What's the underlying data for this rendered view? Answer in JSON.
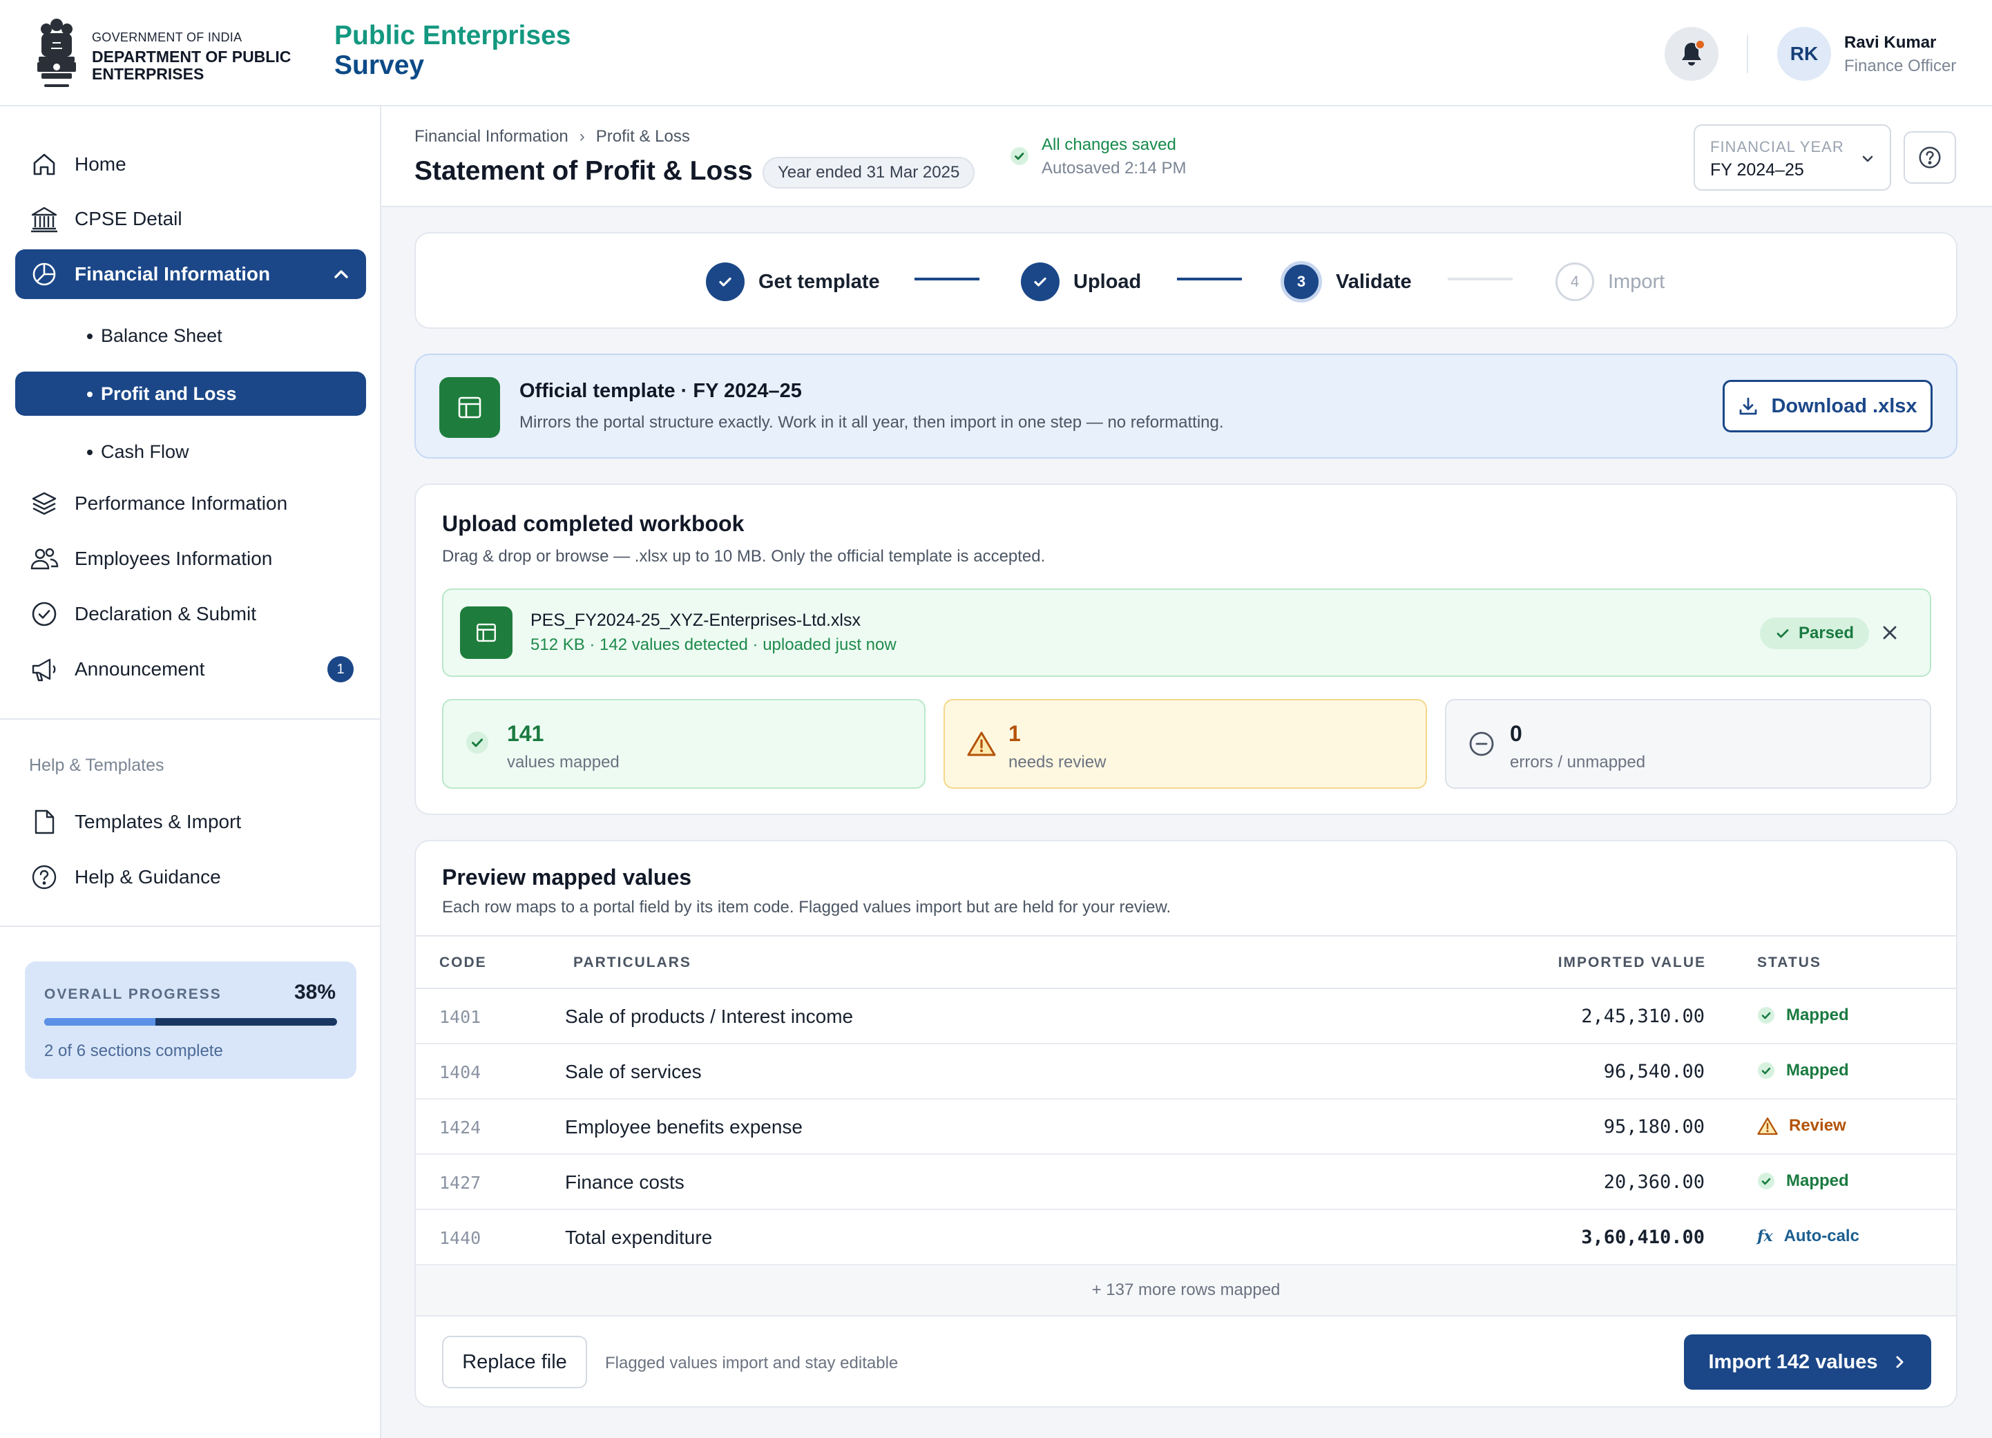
{
  "header": {
    "gov_small": "GOVERNMENT OF INDIA",
    "department": "DEPARTMENT OF PUBLIC ENTERPRISES",
    "brand_accent": "Public Enterprises",
    "brand_rest": "Survey",
    "notification_icon": "bell-icon",
    "user": {
      "initials": "RK",
      "name": "Ravi Kumar",
      "role": "Finance Officer"
    }
  },
  "sidebar": {
    "items": [
      {
        "label": "Home",
        "icon": "home-icon"
      },
      {
        "label": "CPSE Detail",
        "icon": "building-icon"
      },
      {
        "label": "Financial Information",
        "icon": "pie-chart-icon",
        "active": true,
        "expanded": true
      },
      {
        "label": "Performance Information",
        "icon": "layers-icon"
      },
      {
        "label": "Employees Information",
        "icon": "users-icon"
      },
      {
        "label": "Declaration & Submit",
        "icon": "check-circle-icon"
      },
      {
        "label": "Announcement",
        "icon": "megaphone-icon",
        "badge": "1"
      }
    ],
    "subitems": [
      {
        "label": "Balance Sheet"
      },
      {
        "label": "Profit and Loss",
        "active": true
      },
      {
        "label": "Cash Flow"
      }
    ],
    "help_label": "Help & Templates",
    "help_items": [
      {
        "label": "Templates & Import",
        "icon": "file-icon"
      },
      {
        "label": "Help & Guidance",
        "icon": "help-circle-icon"
      }
    ],
    "progress": {
      "label": "OVERALL PROGRESS",
      "percent_text": "38%",
      "fraction": 0.38,
      "sub": "2 of 6 sections complete"
    }
  },
  "page": {
    "breadcrumb": [
      "Financial Information",
      "Profit & Loss"
    ],
    "breadcrumb_sep": "›",
    "title": "Statement of Profit & Loss",
    "year_chip": "Year ended 31 Mar 2025",
    "saved": "All changes saved",
    "autosaved": "Autosaved 2:14 PM",
    "fy_label": "FINANCIAL YEAR",
    "fy_value": "FY 2024–25"
  },
  "stepper": {
    "steps": [
      {
        "label": "Get template",
        "state": "done"
      },
      {
        "label": "Upload",
        "state": "done"
      },
      {
        "label": "Validate",
        "state": "current",
        "number": "3"
      },
      {
        "label": "Import",
        "state": "future",
        "number": "4"
      }
    ]
  },
  "template": {
    "title": "Official template · FY 2024–25",
    "desc": "Mirrors the portal structure exactly. Work in it all year, then import in one step — no reformatting.",
    "download_label": "Download .xlsx"
  },
  "upload": {
    "title": "Upload completed workbook",
    "desc": "Drag & drop or browse — .xlsx up to 10 MB. Only the official template is accepted.",
    "file_name": "PES_FY2024-25_XYZ-Enterprises-Ltd.xlsx",
    "file_meta": "512 KB · 142 values detected · uploaded just now",
    "parsed_label": "Parsed",
    "stats": [
      {
        "num": "141",
        "label": "values mapped"
      },
      {
        "num": "1",
        "label": "needs review"
      },
      {
        "num": "0",
        "label": "errors / unmapped"
      }
    ]
  },
  "preview": {
    "title": "Preview mapped values",
    "desc": "Each row maps to a portal field by its item code. Flagged values import but are held for your review.",
    "columns": [
      "CODE",
      "PARTICULARS",
      "IMPORTED VALUE",
      "STATUS"
    ],
    "rows": [
      {
        "code": "1401",
        "particulars": "Sale of products / Interest income",
        "value": "2,45,310.00",
        "status": "Mapped"
      },
      {
        "code": "1404",
        "particulars": "Sale of services",
        "value": "96,540.00",
        "status": "Mapped"
      },
      {
        "code": "1424",
        "particulars": "Employee benefits expense",
        "value": "95,180.00",
        "status": "Review"
      },
      {
        "code": "1427",
        "particulars": "Finance costs",
        "value": "20,360.00",
        "status": "Mapped"
      },
      {
        "code": "1440",
        "particulars": "Total expenditure",
        "value": "3,60,410.00",
        "status": "Auto-calc"
      }
    ],
    "fx_symbol": "fx",
    "more_rows": "+ 137 more rows mapped",
    "replace_label": "Replace file",
    "note": "Flagged values import and stay editable",
    "import_label": "Import 142 values"
  },
  "colors": {
    "primary": "#1b4788",
    "success": "#1a7a40",
    "warning": "#b35309",
    "teal": "#139880"
  }
}
